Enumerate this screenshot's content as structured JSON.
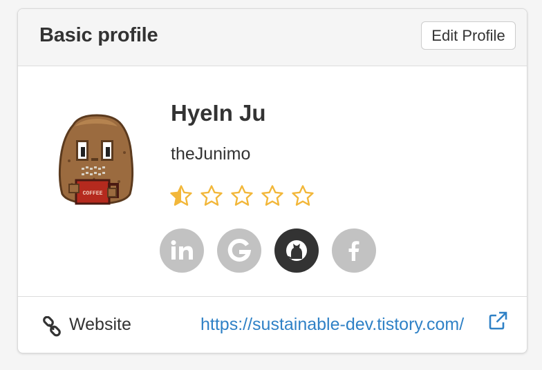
{
  "header": {
    "title": "Basic profile",
    "edit_label": "Edit Profile"
  },
  "profile": {
    "name": "HyeIn Ju",
    "username": "theJunimo",
    "rating": {
      "value": 0.5,
      "max": 5
    },
    "avatar_icon": "potato-coffee-avatar",
    "avatar_mug_text": "COFFEE"
  },
  "social": [
    {
      "name": "linkedin",
      "icon": "linkedin-icon",
      "active": false
    },
    {
      "name": "google",
      "icon": "google-icon",
      "active": false
    },
    {
      "name": "github",
      "icon": "github-icon",
      "active": true
    },
    {
      "name": "facebook",
      "icon": "facebook-icon",
      "active": false
    }
  ],
  "footer": {
    "label": "Website",
    "url": "https://sustainable-dev.tistory.com/"
  },
  "colors": {
    "star": "#f2b73a",
    "link": "#2f81c6",
    "social_inactive": "#c2c2c2",
    "social_active": "#333333"
  }
}
